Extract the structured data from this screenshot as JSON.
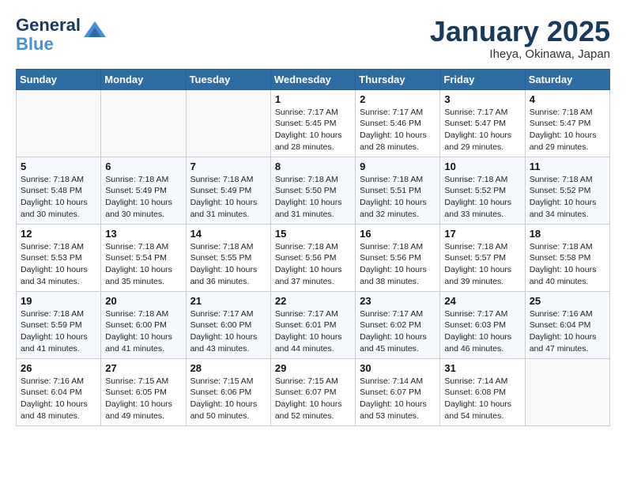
{
  "header": {
    "logo_line1": "General",
    "logo_line2": "Blue",
    "title": "January 2025",
    "subtitle": "Iheya, Okinawa, Japan"
  },
  "weekdays": [
    "Sunday",
    "Monday",
    "Tuesday",
    "Wednesday",
    "Thursday",
    "Friday",
    "Saturday"
  ],
  "weeks": [
    [
      {
        "day": "",
        "info": ""
      },
      {
        "day": "",
        "info": ""
      },
      {
        "day": "",
        "info": ""
      },
      {
        "day": "1",
        "info": "Sunrise: 7:17 AM\nSunset: 5:45 PM\nDaylight: 10 hours\nand 28 minutes."
      },
      {
        "day": "2",
        "info": "Sunrise: 7:17 AM\nSunset: 5:46 PM\nDaylight: 10 hours\nand 28 minutes."
      },
      {
        "day": "3",
        "info": "Sunrise: 7:17 AM\nSunset: 5:47 PM\nDaylight: 10 hours\nand 29 minutes."
      },
      {
        "day": "4",
        "info": "Sunrise: 7:18 AM\nSunset: 5:47 PM\nDaylight: 10 hours\nand 29 minutes."
      }
    ],
    [
      {
        "day": "5",
        "info": "Sunrise: 7:18 AM\nSunset: 5:48 PM\nDaylight: 10 hours\nand 30 minutes."
      },
      {
        "day": "6",
        "info": "Sunrise: 7:18 AM\nSunset: 5:49 PM\nDaylight: 10 hours\nand 30 minutes."
      },
      {
        "day": "7",
        "info": "Sunrise: 7:18 AM\nSunset: 5:49 PM\nDaylight: 10 hours\nand 31 minutes."
      },
      {
        "day": "8",
        "info": "Sunrise: 7:18 AM\nSunset: 5:50 PM\nDaylight: 10 hours\nand 31 minutes."
      },
      {
        "day": "9",
        "info": "Sunrise: 7:18 AM\nSunset: 5:51 PM\nDaylight: 10 hours\nand 32 minutes."
      },
      {
        "day": "10",
        "info": "Sunrise: 7:18 AM\nSunset: 5:52 PM\nDaylight: 10 hours\nand 33 minutes."
      },
      {
        "day": "11",
        "info": "Sunrise: 7:18 AM\nSunset: 5:52 PM\nDaylight: 10 hours\nand 34 minutes."
      }
    ],
    [
      {
        "day": "12",
        "info": "Sunrise: 7:18 AM\nSunset: 5:53 PM\nDaylight: 10 hours\nand 34 minutes."
      },
      {
        "day": "13",
        "info": "Sunrise: 7:18 AM\nSunset: 5:54 PM\nDaylight: 10 hours\nand 35 minutes."
      },
      {
        "day": "14",
        "info": "Sunrise: 7:18 AM\nSunset: 5:55 PM\nDaylight: 10 hours\nand 36 minutes."
      },
      {
        "day": "15",
        "info": "Sunrise: 7:18 AM\nSunset: 5:56 PM\nDaylight: 10 hours\nand 37 minutes."
      },
      {
        "day": "16",
        "info": "Sunrise: 7:18 AM\nSunset: 5:56 PM\nDaylight: 10 hours\nand 38 minutes."
      },
      {
        "day": "17",
        "info": "Sunrise: 7:18 AM\nSunset: 5:57 PM\nDaylight: 10 hours\nand 39 minutes."
      },
      {
        "day": "18",
        "info": "Sunrise: 7:18 AM\nSunset: 5:58 PM\nDaylight: 10 hours\nand 40 minutes."
      }
    ],
    [
      {
        "day": "19",
        "info": "Sunrise: 7:18 AM\nSunset: 5:59 PM\nDaylight: 10 hours\nand 41 minutes."
      },
      {
        "day": "20",
        "info": "Sunrise: 7:18 AM\nSunset: 6:00 PM\nDaylight: 10 hours\nand 41 minutes."
      },
      {
        "day": "21",
        "info": "Sunrise: 7:17 AM\nSunset: 6:00 PM\nDaylight: 10 hours\nand 43 minutes."
      },
      {
        "day": "22",
        "info": "Sunrise: 7:17 AM\nSunset: 6:01 PM\nDaylight: 10 hours\nand 44 minutes."
      },
      {
        "day": "23",
        "info": "Sunrise: 7:17 AM\nSunset: 6:02 PM\nDaylight: 10 hours\nand 45 minutes."
      },
      {
        "day": "24",
        "info": "Sunrise: 7:17 AM\nSunset: 6:03 PM\nDaylight: 10 hours\nand 46 minutes."
      },
      {
        "day": "25",
        "info": "Sunrise: 7:16 AM\nSunset: 6:04 PM\nDaylight: 10 hours\nand 47 minutes."
      }
    ],
    [
      {
        "day": "26",
        "info": "Sunrise: 7:16 AM\nSunset: 6:04 PM\nDaylight: 10 hours\nand 48 minutes."
      },
      {
        "day": "27",
        "info": "Sunrise: 7:15 AM\nSunset: 6:05 PM\nDaylight: 10 hours\nand 49 minutes."
      },
      {
        "day": "28",
        "info": "Sunrise: 7:15 AM\nSunset: 6:06 PM\nDaylight: 10 hours\nand 50 minutes."
      },
      {
        "day": "29",
        "info": "Sunrise: 7:15 AM\nSunset: 6:07 PM\nDaylight: 10 hours\nand 52 minutes."
      },
      {
        "day": "30",
        "info": "Sunrise: 7:14 AM\nSunset: 6:07 PM\nDaylight: 10 hours\nand 53 minutes."
      },
      {
        "day": "31",
        "info": "Sunrise: 7:14 AM\nSunset: 6:08 PM\nDaylight: 10 hours\nand 54 minutes."
      },
      {
        "day": "",
        "info": ""
      }
    ]
  ]
}
